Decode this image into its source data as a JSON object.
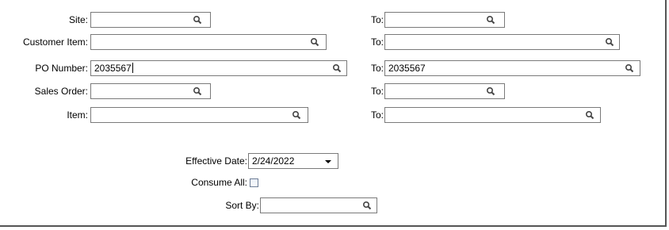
{
  "form": {
    "site": {
      "label": "Site:",
      "value": "",
      "to_label": "To:",
      "to_value": ""
    },
    "customer_item": {
      "label": "Customer Item:",
      "value": "",
      "to_label": "To:",
      "to_value": ""
    },
    "po_number": {
      "label": "PO Number:",
      "value": "2035567",
      "to_label": "To:",
      "to_value": "2035567"
    },
    "sales_order": {
      "label": "Sales Order:",
      "value": "",
      "to_label": "To:",
      "to_value": ""
    },
    "item": {
      "label": "Item:",
      "value": "",
      "to_label": "To:",
      "to_value": ""
    },
    "effective_date": {
      "label": "Effective Date:",
      "value": "2/24/2022"
    },
    "consume_all": {
      "label": "Consume All:",
      "checked": false
    },
    "sort_by": {
      "label": "Sort By:",
      "value": ""
    }
  },
  "icons": {
    "lookup": "search-icon",
    "dropdown": "dropdown-arrow-icon"
  }
}
